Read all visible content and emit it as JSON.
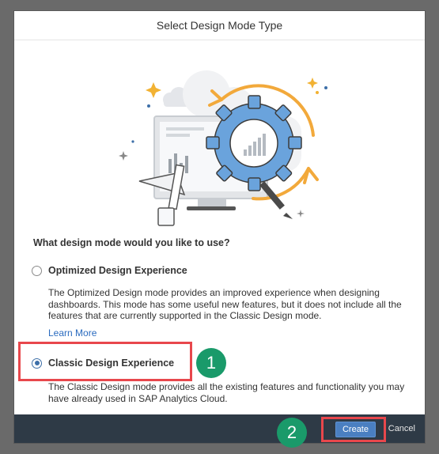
{
  "dialog": {
    "title": "Select Design Mode Type"
  },
  "question": "What design mode would you like to use?",
  "options": [
    {
      "label": "Optimized Design Experience",
      "selected": false,
      "description": "The Optimized Design mode provides an improved experience when designing dashboards. This mode has some useful new features, but it does not include all the features that are currently supported in the Classic Design mode.",
      "link": "Learn More"
    },
    {
      "label": "Classic Design Experience",
      "selected": true,
      "description": "The Classic Design mode provides all the existing features and functionality you may have already used in SAP Analytics Cloud."
    }
  ],
  "footer": {
    "create_label": "Create",
    "cancel_label": "Cancel"
  },
  "annotations": {
    "step1": "1",
    "step2": "2",
    "highlight_color": "#e8474c",
    "badge_color": "#1a9a6a"
  },
  "colors": {
    "accent": "#4a7fc1",
    "footer_bg": "#2e3a46",
    "gear": "#6aa3dc",
    "arrow": "#f2a93b"
  },
  "illustration": {
    "icons": [
      "monitor-icon",
      "gear-icon",
      "bar-chart-icon",
      "ruler-icon",
      "pen-icon",
      "cloud-icon",
      "sparkle-icon",
      "cycle-arrow-icon"
    ]
  }
}
